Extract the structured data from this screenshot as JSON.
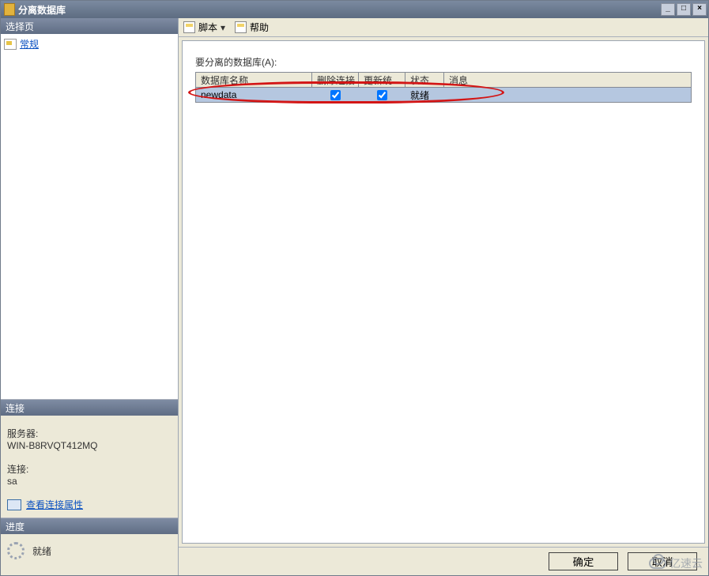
{
  "window": {
    "title": "分离数据库",
    "min_icon": "_",
    "max_icon": "□",
    "close_icon": "×"
  },
  "left": {
    "select_page_hdr": "选择页",
    "page_general": "常规",
    "connection_hdr": "连接",
    "server_label": "服务器:",
    "server_value": "WIN-B8RVQT412MQ",
    "connection_label": "连接:",
    "connection_value": "sa",
    "view_props": "查看连接属性",
    "progress_hdr": "进度",
    "progress_state": "就绪"
  },
  "toolbar": {
    "script": "脚本",
    "help": "帮助",
    "drop_arrow": "▾"
  },
  "main": {
    "prompt": "要分离的数据库(A):",
    "columns": {
      "name": "数据库名称",
      "drop": "删除连接",
      "update": "更新统…",
      "state": "状态",
      "msg": "消息"
    },
    "rows": [
      {
        "name": "newdata",
        "drop": true,
        "update": true,
        "state": "就绪",
        "msg": ""
      }
    ]
  },
  "footer": {
    "ok": "确定",
    "cancel": "取消"
  },
  "watermark": "亿速云"
}
